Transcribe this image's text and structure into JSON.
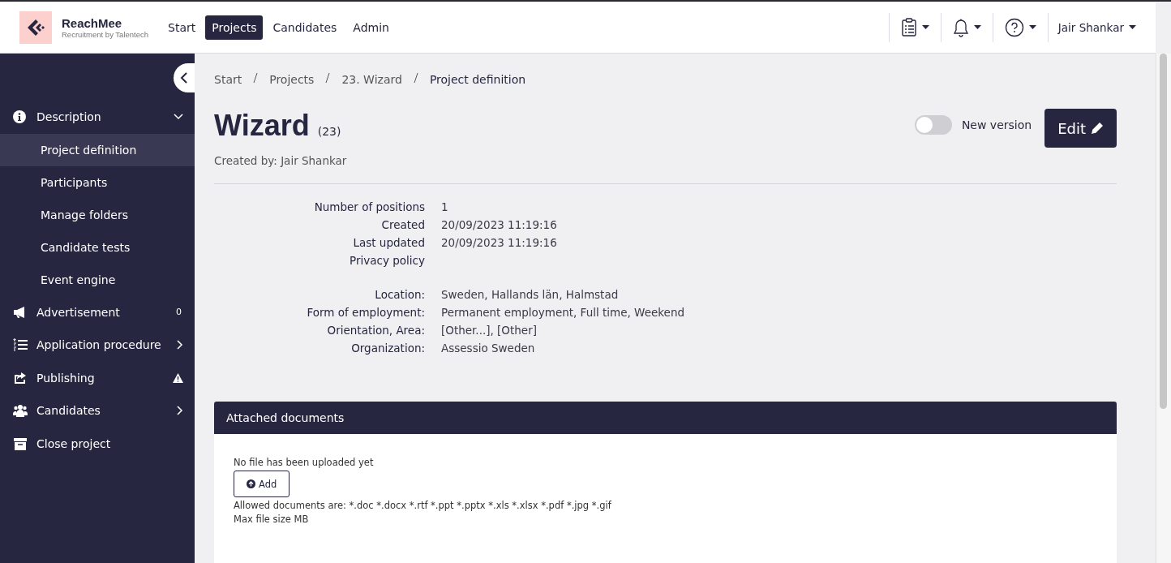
{
  "brand": {
    "name": "ReachMee",
    "tagline": "Recruitment by Talentech"
  },
  "nav": [
    {
      "label": "Start",
      "selected": false
    },
    {
      "label": "Projects",
      "selected": true
    },
    {
      "label": "Candidates",
      "selected": false
    },
    {
      "label": "Admin",
      "selected": false
    }
  ],
  "user": {
    "name": "Jair Shankar"
  },
  "sidebar": {
    "items": [
      {
        "label": "Description",
        "expanded": true,
        "children": [
          {
            "label": "Project definition",
            "selected": true
          },
          {
            "label": "Participants",
            "selected": false
          },
          {
            "label": "Manage folders",
            "selected": false
          },
          {
            "label": "Candidate tests",
            "selected": false
          },
          {
            "label": "Event engine",
            "selected": false
          }
        ]
      },
      {
        "label": "Advertisement",
        "count": "0"
      },
      {
        "label": "Application procedure",
        "expanded": false
      },
      {
        "label": "Publishing",
        "warning": true
      },
      {
        "label": "Candidates",
        "expanded": false
      },
      {
        "label": "Close project"
      }
    ]
  },
  "breadcrumb": [
    "Start",
    "Projects",
    "23. Wizard",
    "Project definition"
  ],
  "project": {
    "title": "Wizard",
    "number": "(23)",
    "created_by": "Created by: Jair Shankar"
  },
  "new_version": {
    "label": "New version",
    "on": false
  },
  "edit_button": "Edit",
  "details": [
    [
      {
        "label": "Number of positions",
        "value": "1"
      },
      {
        "label": "Created",
        "value": "20/09/2023 11:19:16"
      },
      {
        "label": "Last updated",
        "value": "20/09/2023 11:19:16"
      },
      {
        "label": "Privacy policy"
      }
    ],
    [
      {
        "label": "Location:",
        "value": "Sweden, Hallands län, Halmstad"
      },
      {
        "label": "Form of employment:",
        "value": "Permanent employment, Full time, Weekend"
      },
      {
        "label": "Orientation, Area:",
        "value": "[Other...], [Other]"
      },
      {
        "label": "Organization:",
        "value": "Assessio Sweden"
      }
    ]
  ],
  "attachments": {
    "title": "Attached documents",
    "empty_text": "No file has been uploaded yet",
    "add_button": "Add",
    "allowed": "Allowed documents are: *.doc *.docx *.rtf *.ppt *.pptx *.xls *.xlsx *.pdf *.jpg *.gif",
    "max_size": "Max file size MB"
  }
}
